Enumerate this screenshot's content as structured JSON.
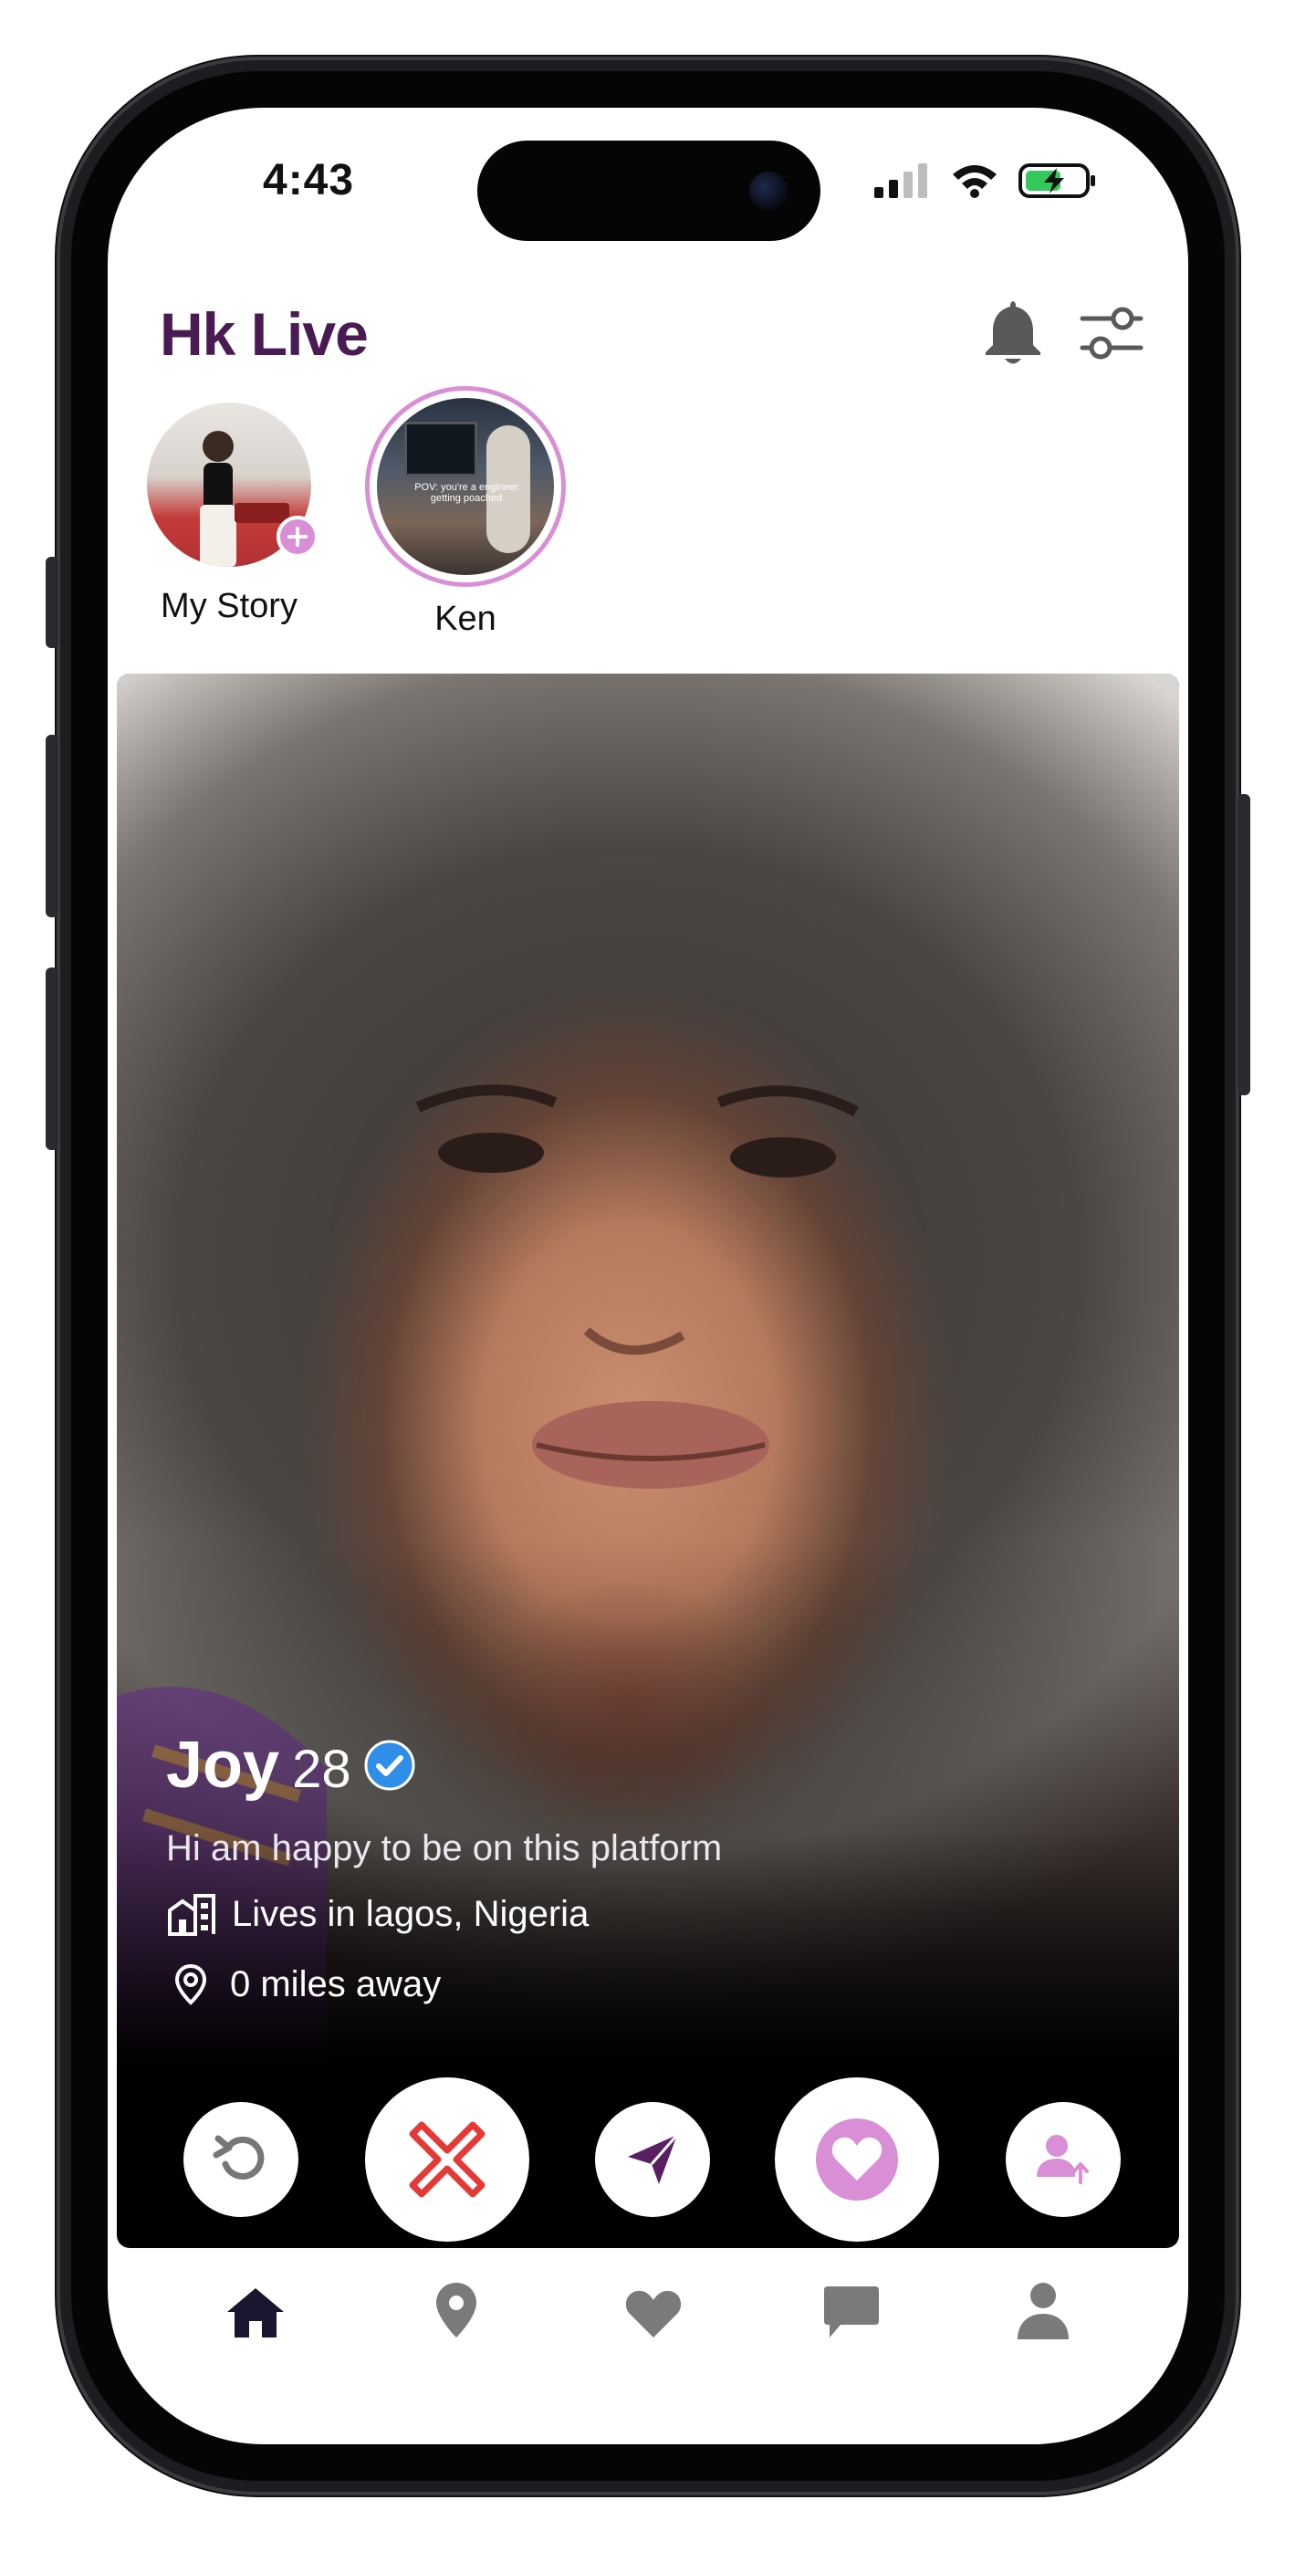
{
  "status_bar": {
    "time": "4:43"
  },
  "header": {
    "title": "Hk Live"
  },
  "stories": [
    {
      "label": "My Story"
    },
    {
      "label": "Ken",
      "thumb_caption": "POV: you're a engineer getting poached"
    }
  ],
  "profile": {
    "name": "Joy",
    "age": "28",
    "verified": true,
    "bio": "Hi am happy to be on this platform",
    "location": "Lives in lagos, Nigeria",
    "distance": "0 miles away"
  },
  "actions": [
    {
      "icon": "undo-icon"
    },
    {
      "icon": "dislike-x-icon"
    },
    {
      "icon": "send-icon"
    },
    {
      "icon": "like-heart-icon"
    },
    {
      "icon": "boost-profile-icon"
    }
  ],
  "tabs": [
    {
      "icon": "home-icon",
      "active": true
    },
    {
      "icon": "location-pin-icon"
    },
    {
      "icon": "heart-icon"
    },
    {
      "icon": "chat-icon"
    },
    {
      "icon": "profile-icon"
    }
  ],
  "colors": {
    "brand": "#4a1a52",
    "accent_pink": "#d98fd6",
    "dislike_red": "#e53935",
    "send_purple": "#5a1f62",
    "tab_inactive": "#7a7a7a",
    "verified_blue": "#2f8fe8"
  }
}
